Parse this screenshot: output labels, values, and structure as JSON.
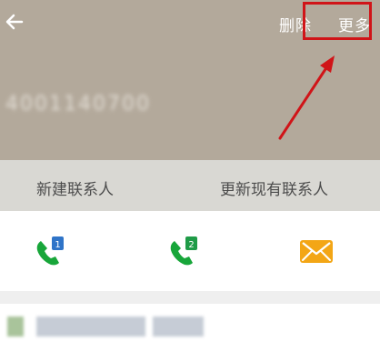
{
  "header": {
    "delete_label": "删除",
    "more_label": "更多",
    "phone_number": "4001140700"
  },
  "actions": {
    "new_contact": "新建联系人",
    "update_contact": "更新现有联系人"
  },
  "dial": {
    "sim1": "1",
    "sim2": "2"
  },
  "colors": {
    "header_bg": "#b3a99b",
    "green": "#18a63a",
    "blue_badge": "#2f74c8",
    "green_badge": "#1f9b47",
    "orange": "#f3a616",
    "highlight": "#d01418"
  }
}
